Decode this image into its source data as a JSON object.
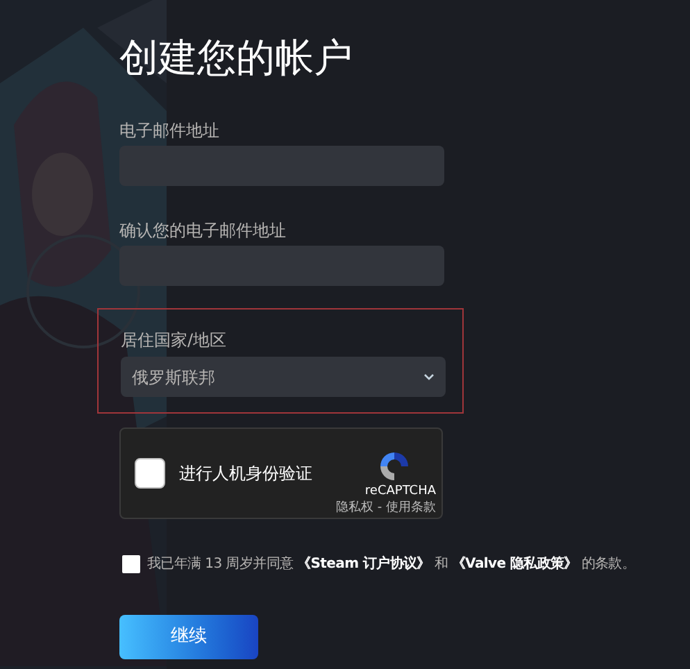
{
  "title": "创建您的帐户",
  "fields": [
    {
      "label": "电子邮件地址"
    },
    {
      "label": "确认您的电子邮件地址"
    }
  ],
  "country": {
    "label": "居住国家/地区",
    "value": "俄罗斯联邦",
    "highlighted": true
  },
  "captcha": {
    "checked": false,
    "label": "进行人机身份验证",
    "brand": "reCAPTCHA",
    "links": "隐私权 - 使用条款"
  },
  "agreement": {
    "checked": false,
    "text": "我已年满 13 周岁并同意 **《Steam 订户协议》** 和 **《Valve 隐私政策》** 的条款。"
  },
  "submit": "继续"
}
